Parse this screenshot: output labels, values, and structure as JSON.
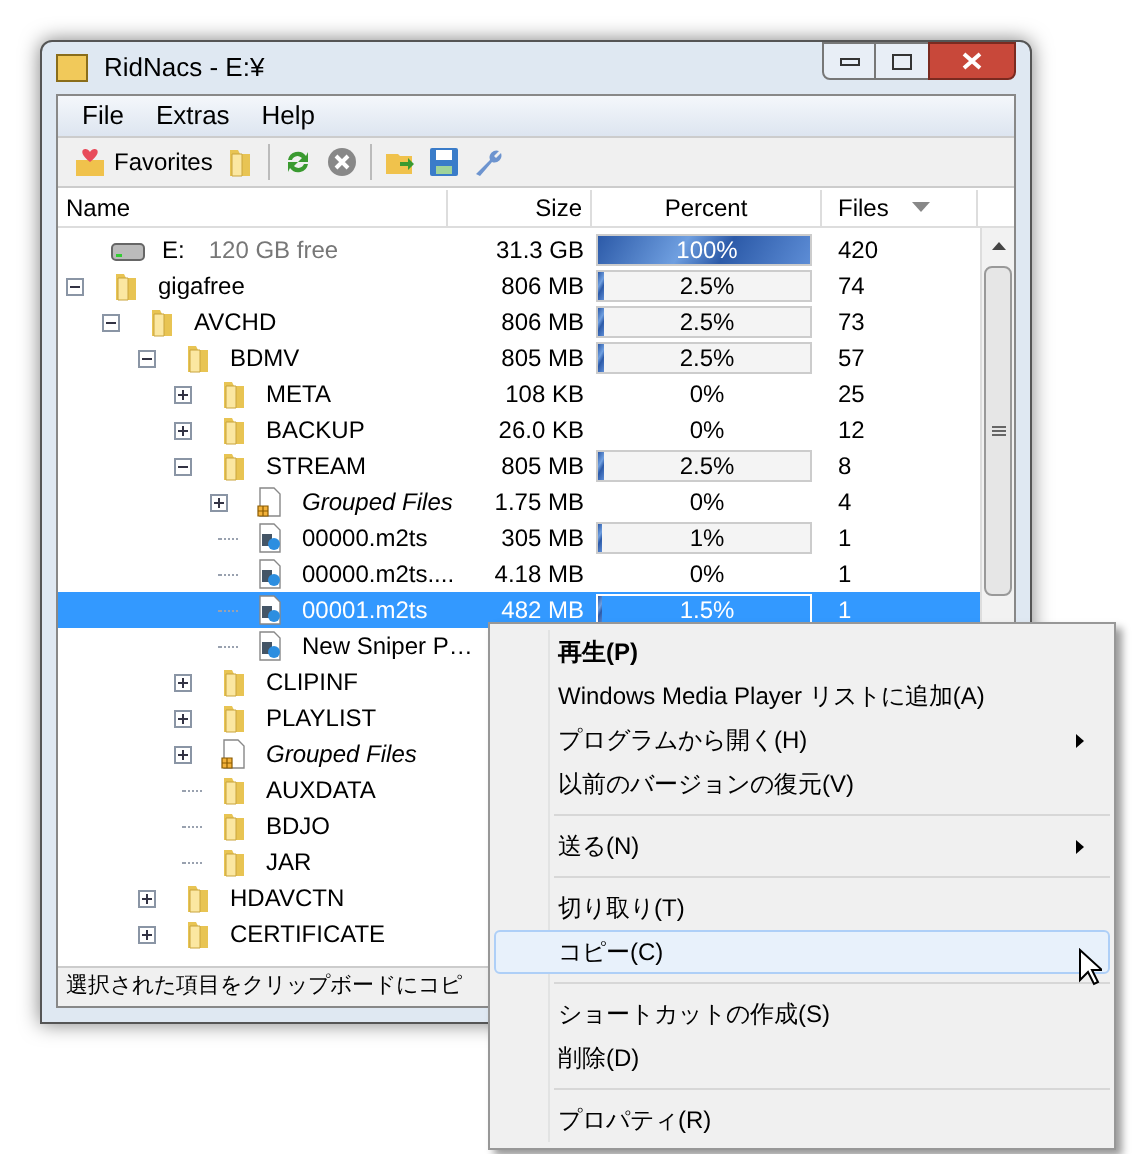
{
  "window": {
    "title": "RidNacs - E:¥"
  },
  "menu": [
    "File",
    "Extras",
    "Help"
  ],
  "toolbar": {
    "favorites": "Favorites"
  },
  "columns": [
    "Name",
    "Size",
    "Percent",
    "Files"
  ],
  "tree": [
    {
      "kind": "drive",
      "name": "E:",
      "note": "120 GB free",
      "size": "31.3 GB",
      "percent": "100%",
      "level": 1,
      "files": "420",
      "selected": false
    },
    {
      "kind": "folder",
      "name": "gigafree",
      "size": "806 MB",
      "percent": "2.5%",
      "level": 0.025,
      "files": "74",
      "selected": false,
      "expanded": true,
      "children": [
        {
          "kind": "folder",
          "name": "AVCHD",
          "size": "806 MB",
          "percent": "2.5%",
          "level": 0.025,
          "files": "73",
          "selected": false,
          "expanded": true,
          "children": [
            {
              "kind": "folder",
              "name": "BDMV",
              "size": "805 MB",
              "percent": "2.5%",
              "level": 0.025,
              "files": "57",
              "selected": false,
              "expanded": true,
              "children": [
                {
                  "kind": "folder",
                  "name": "META",
                  "size": "108 KB",
                  "percent": "0%",
                  "files": "25",
                  "selected": false,
                  "expanded": false
                },
                {
                  "kind": "folder",
                  "name": "BACKUP",
                  "size": "26.0 KB",
                  "percent": "0%",
                  "files": "12",
                  "selected": false,
                  "expanded": false
                },
                {
                  "kind": "folder",
                  "name": "STREAM",
                  "size": "805 MB",
                  "percent": "2.5%",
                  "level": 0.025,
                  "files": "8",
                  "selected": false,
                  "expanded": true,
                  "children": [
                    {
                      "kind": "group",
                      "name": "Grouped Files",
                      "size": "1.75 MB",
                      "percent": "0%",
                      "files": "4",
                      "selected": false,
                      "expanded": false
                    },
                    {
                      "kind": "media",
                      "name": "00000.m2ts",
                      "size": "305 MB",
                      "percent": "1%",
                      "level": 0.01,
                      "files": "1",
                      "selected": false
                    },
                    {
                      "kind": "media",
                      "name": "00000.m2ts....",
                      "size": "4.18 MB",
                      "percent": "0%",
                      "files": "1",
                      "selected": false
                    },
                    {
                      "kind": "media",
                      "name": "00001.m2ts",
                      "size": "482 MB",
                      "percent": "1.5%",
                      "level": 0.015,
                      "files": "1",
                      "selected": true
                    },
                    {
                      "kind": "media",
                      "name": "New Sniper P…",
                      "selected": false
                    }
                  ]
                },
                {
                  "kind": "folder",
                  "name": "CLIPINF",
                  "selected": false,
                  "expanded": false
                },
                {
                  "kind": "folder",
                  "name": "PLAYLIST",
                  "selected": false,
                  "expanded": false
                },
                {
                  "kind": "group",
                  "name": "Grouped Files",
                  "selected": false,
                  "expanded": false
                },
                {
                  "kind": "folder",
                  "name": "AUXDATA",
                  "selected": false
                },
                {
                  "kind": "folder",
                  "name": "BDJO",
                  "selected": false
                },
                {
                  "kind": "folder",
                  "name": "JAR",
                  "selected": false
                }
              ]
            },
            {
              "kind": "folder",
              "name": "HDAVCTN",
              "selected": false,
              "expanded": false
            },
            {
              "kind": "folder",
              "name": "CERTIFICATE",
              "selected": false,
              "expanded": false
            }
          ]
        }
      ]
    }
  ],
  "status_bar": "選択された項目をクリップボードにコピ",
  "context_menu": [
    {
      "kind": "item",
      "label": "再生(P)",
      "bold": true,
      "submenu": false,
      "selected": false
    },
    {
      "kind": "item",
      "label": "Windows Media Player リストに追加(A)",
      "bold": false,
      "submenu": false,
      "selected": false
    },
    {
      "kind": "item",
      "label": "プログラムから開く(H)",
      "bold": false,
      "submenu": true,
      "selected": false
    },
    {
      "kind": "item",
      "label": "以前のバージョンの復元(V)",
      "bold": false,
      "submenu": false,
      "selected": false
    },
    {
      "kind": "separator"
    },
    {
      "kind": "item",
      "label": "送る(N)",
      "bold": false,
      "submenu": true,
      "selected": false
    },
    {
      "kind": "separator"
    },
    {
      "kind": "item",
      "label": "切り取り(T)",
      "bold": false,
      "submenu": false,
      "selected": false
    },
    {
      "kind": "item",
      "label": "コピー(C)",
      "bold": false,
      "submenu": false,
      "selected": true
    },
    {
      "kind": "separator"
    },
    {
      "kind": "item",
      "label": "ショートカットの作成(S)",
      "bold": false,
      "submenu": false,
      "selected": false
    },
    {
      "kind": "item",
      "label": "削除(D)",
      "bold": false,
      "submenu": false,
      "selected": false
    },
    {
      "kind": "separator"
    },
    {
      "kind": "item",
      "label": "プロパティ(R)",
      "bold": false,
      "submenu": false,
      "selected": false
    }
  ]
}
